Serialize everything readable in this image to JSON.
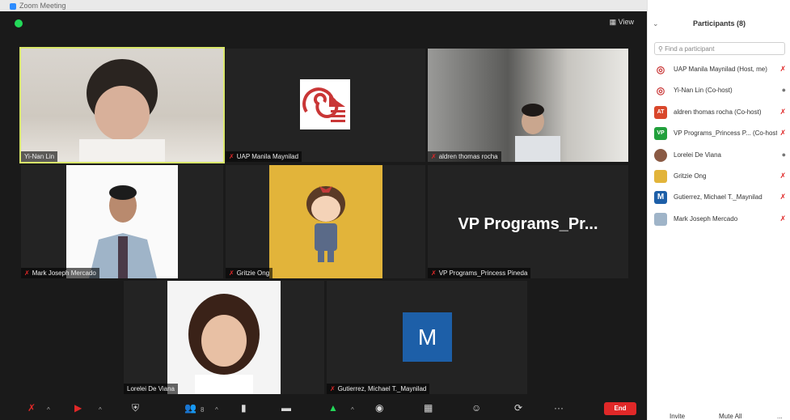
{
  "window": {
    "title": "Zoom Meeting",
    "view_label": "View"
  },
  "tiles": [
    {
      "name": "Yi-Nan Lin",
      "muted": false,
      "active": true
    },
    {
      "name": "UAP Manila Maynilad",
      "muted": true
    },
    {
      "name": "aldren thomas rocha",
      "muted": true
    },
    {
      "name": "Mark Joseph Mercado",
      "muted": true
    },
    {
      "name": "Gritzie Ong",
      "muted": true
    },
    {
      "name": "VP Programs_Princess Pineda",
      "muted": true,
      "display_text": "VP Programs_Pr..."
    },
    {
      "name": "Lorelei De Viana",
      "muted": false
    },
    {
      "name": "Gutierrez, Michael T._Maynilad",
      "muted": true,
      "avatar_letter": "M"
    }
  ],
  "toolbar": {
    "end_label": "End",
    "participants_count": "8"
  },
  "participants_panel": {
    "title": "Participants (8)",
    "search_placeholder": "Find a participant",
    "participants": [
      {
        "name": "UAP Manila Maynilad (Host, me)",
        "muted": true,
        "avatar": "logo"
      },
      {
        "name": "Yi-Nan Lin (Co-host)",
        "muted": false,
        "avatar": "logo"
      },
      {
        "name": "aldren thomas rocha (Co-host)",
        "muted": true,
        "avatar": "AT",
        "avatar_color": "#d9472b"
      },
      {
        "name": "VP Programs_Princess P... (Co-host)",
        "muted": true,
        "avatar": "VP",
        "avatar_color": "#22a03c"
      },
      {
        "name": "Lorelei De Viana",
        "muted": false,
        "avatar": "photo"
      },
      {
        "name": "Gritzie Ong",
        "muted": true,
        "avatar": "photo"
      },
      {
        "name": "Gutierrez, Michael T._Maynilad",
        "muted": true,
        "avatar": "M",
        "avatar_color": "#1d5fa8"
      },
      {
        "name": "Mark Joseph Mercado",
        "muted": true,
        "avatar": "photo"
      }
    ],
    "invite_label": "Invite",
    "mute_all_label": "Mute All",
    "more_label": "..."
  }
}
